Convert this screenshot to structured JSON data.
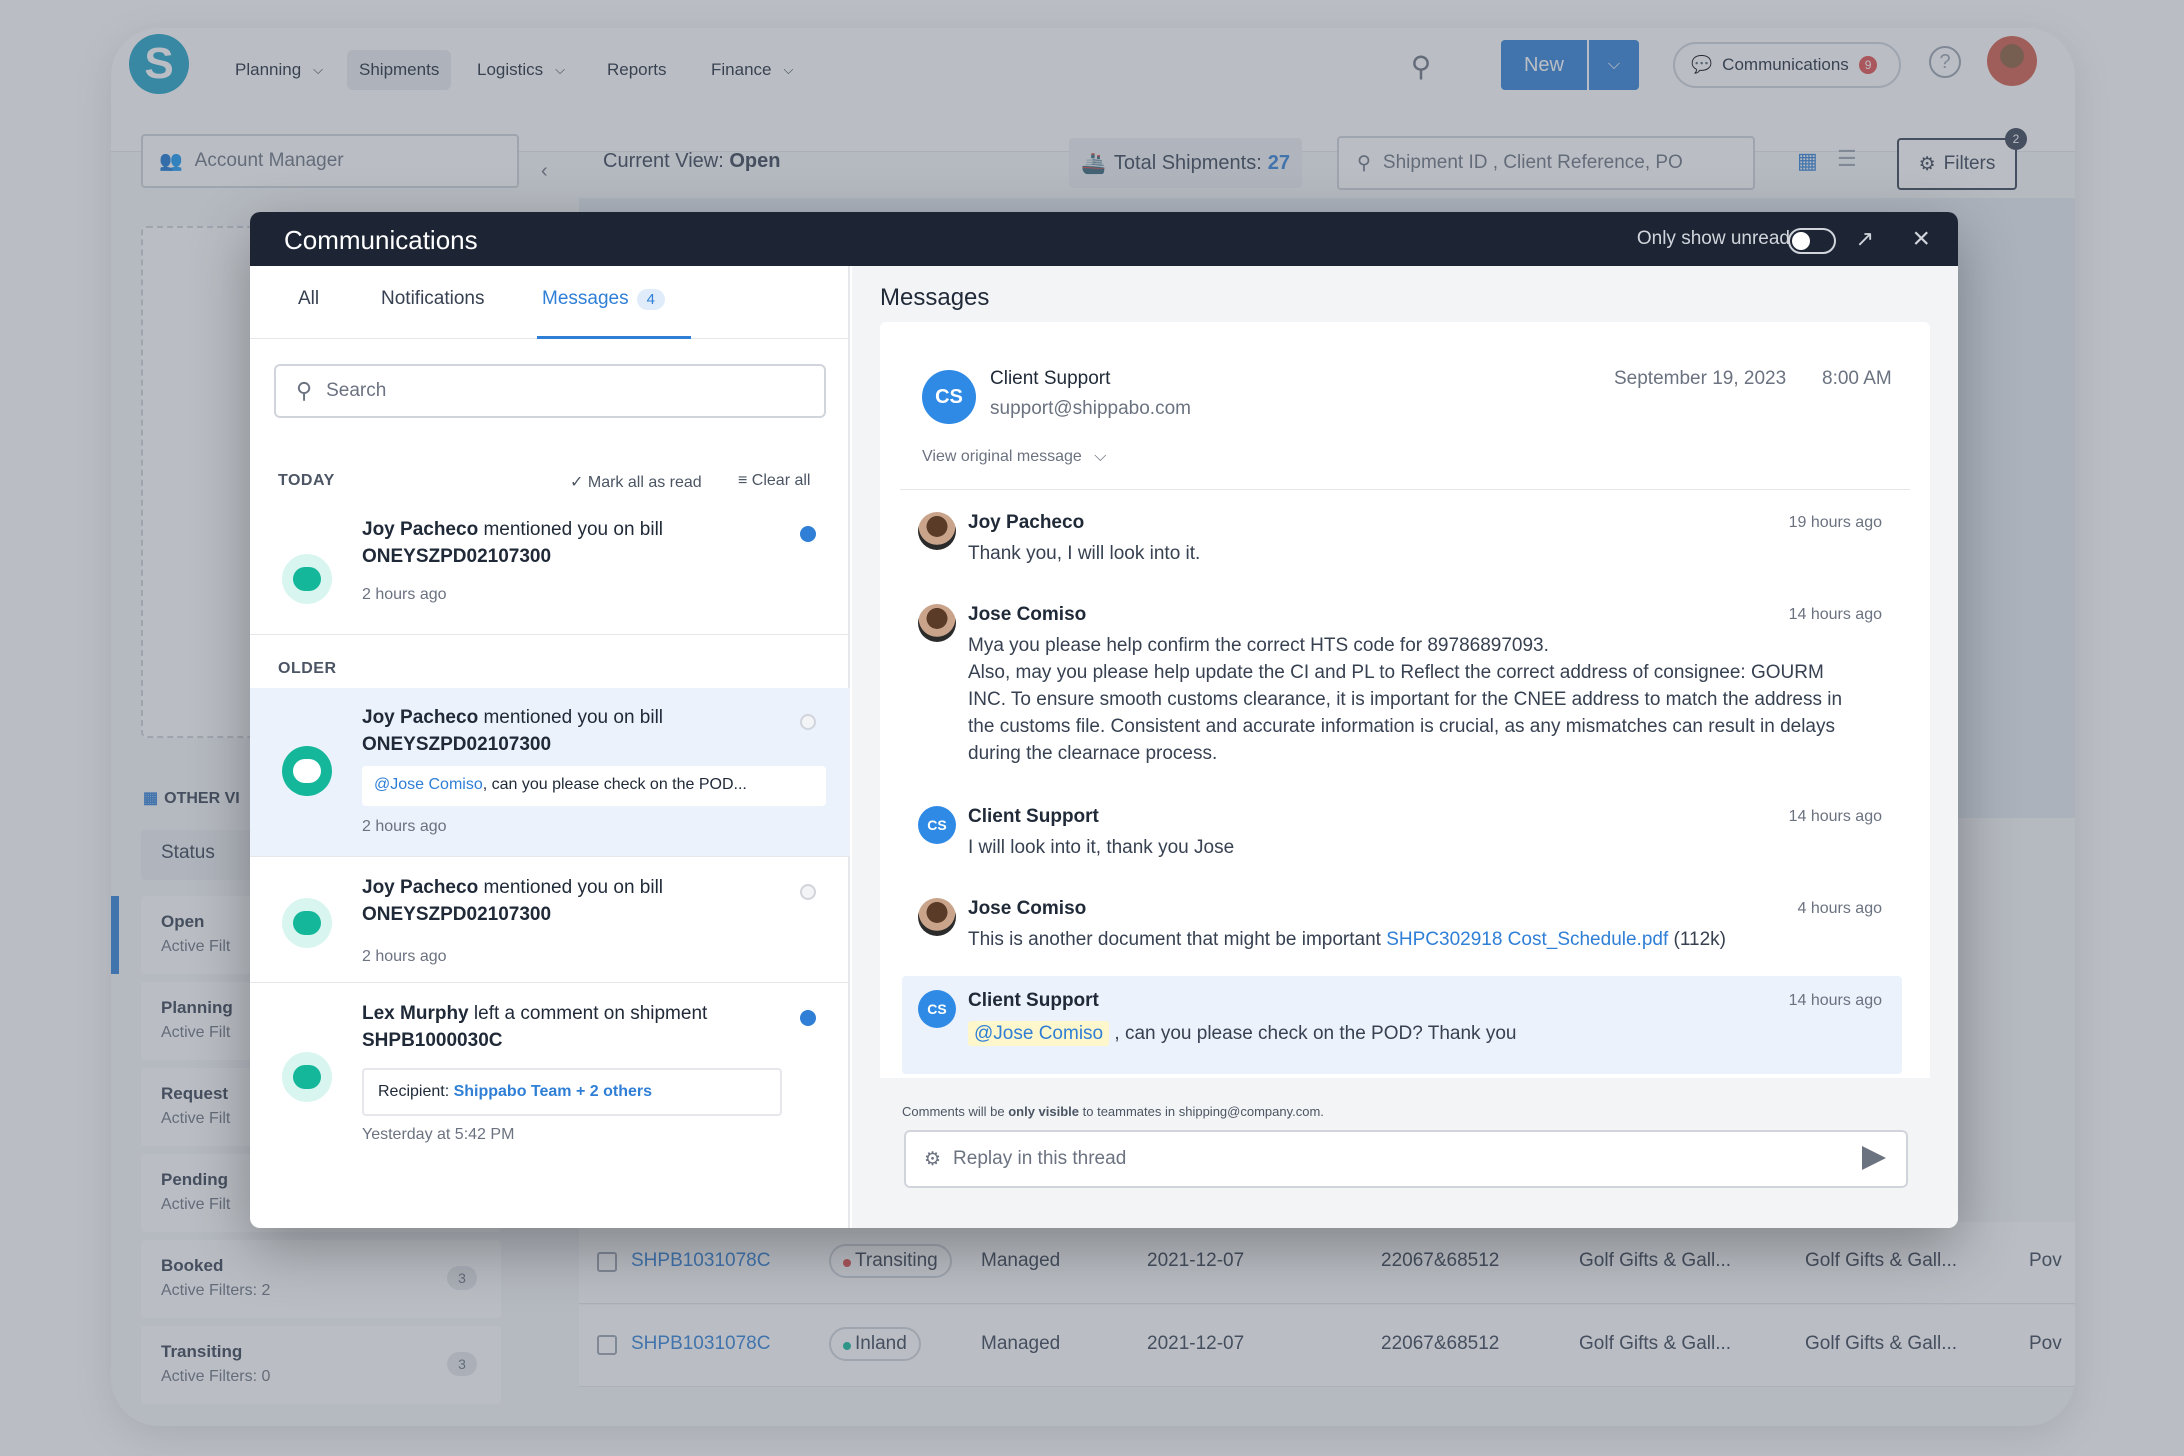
{
  "app": {
    "logo": "S",
    "nav": [
      {
        "label": "Planning",
        "dropdown": true
      },
      {
        "label": "Shipments",
        "dropdown": false
      },
      {
        "label": "Logistics",
        "dropdown": true
      },
      {
        "label": "Reports",
        "dropdown": false
      },
      {
        "label": "Finance",
        "dropdown": true
      }
    ],
    "new_label": "New",
    "communications_label": "Communications",
    "communications_count": "9",
    "help": "?"
  },
  "toolbar": {
    "account_manager": "Account Manager",
    "current_view_label": "Current View:",
    "current_view_value": "Open",
    "total_label": "Total Shipments:",
    "total_value": "27",
    "search_placeholder": "Shipment ID , Client Reference, PO",
    "filters_label": "Filters",
    "filters_count": "2"
  },
  "sidebar": {
    "other_views": "OTHER VI",
    "status_label": "Status",
    "items": [
      {
        "title": "Open",
        "sub": "Active Filt",
        "count": ""
      },
      {
        "title": "Planning",
        "sub": "Active Filt",
        "count": ""
      },
      {
        "title": "Request",
        "sub": "Active Filt",
        "count": ""
      },
      {
        "title": "Pending",
        "sub": "Active Filt",
        "count": ""
      },
      {
        "title": "Booked",
        "sub": "Active Filters: 2",
        "count": "3"
      },
      {
        "title": "Transiting",
        "sub": "Active Filters: 0",
        "count": "3"
      }
    ]
  },
  "table": {
    "rows": [
      {
        "id": "SHPB1031078C",
        "status": "Transiting",
        "status_color": "#e24c4c",
        "mgmt": "Managed",
        "date": "2021-12-07",
        "ref": "22067&68512",
        "shipper": "Golf Gifts & Gall...",
        "consignee": "Golf Gifts & Gall...",
        "extra": "Pov"
      },
      {
        "id": "SHPB1031078C",
        "status": "Inland",
        "status_color": "#14b79a",
        "mgmt": "Managed",
        "date": "2021-12-07",
        "ref": "22067&68512",
        "shipper": "Golf Gifts & Gall...",
        "consignee": "Golf Gifts & Gall...",
        "extra": "Pov"
      }
    ]
  },
  "modal": {
    "title": "Communications",
    "only_unread": "Only show unread",
    "tabs": {
      "all": "All",
      "notifications": "Notifications",
      "messages": "Messages",
      "messages_count": "4"
    },
    "search_placeholder": "Search",
    "today_label": "TODAY",
    "older_label": "OLDER",
    "mark_all_read": "Mark all as read",
    "clear_all": "Clear all",
    "notifications": [
      {
        "actor": "Joy Pacheco",
        "action": " mentioned you on bill",
        "ref": "ONEYSZPD02107300",
        "time": "2 hours ago"
      },
      {
        "actor": "Joy Pacheco",
        "action": " mentioned you on bill",
        "ref": "ONEYSZPD02107300",
        "quote_mention": "@Jose Comiso",
        "quote_text": ", can you please check on the POD...",
        "time": "2 hours ago"
      },
      {
        "actor": "Joy Pacheco",
        "action": " mentioned you on bill",
        "ref": "ONEYSZPD02107300",
        "time": "2 hours ago"
      },
      {
        "actor": "Lex Murphy",
        "action": " left a comment on shipment",
        "ref": "SHPB1000030C",
        "recipient_label": "Recipient: ",
        "recipient_value": "Shippabo Team + 2 others",
        "time": "Yesterday at 5:42 PM"
      }
    ],
    "messages_title": "Messages",
    "thread": {
      "sender": "Client Support",
      "sender_initials": "CS",
      "email": "support@shippabo.com",
      "date": "September 19, 2023",
      "time": "8:00 AM",
      "view_original": "View original message"
    },
    "messages": [
      {
        "name": "Joy Pacheco",
        "time": "19 hours ago",
        "body": "Thank you, I will look into it."
      },
      {
        "name": "Jose Comiso",
        "time": "14 hours ago",
        "body": "Mya you please help confirm the correct HTS code for 89786897093.\nAlso, may you please help update the CI and PL to Reflect the correct address of consignee: GOURM INC. To ensure smooth customs clearance, it is important for the CNEE address to match the address in the customs file. Consistent and accurate information is crucial, as any mismatches can result in delays during the clearnace process."
      },
      {
        "name": "Client Support",
        "initials": "CS",
        "time": "14 hours ago",
        "body": "I will look into it, thank you Jose"
      },
      {
        "name": "Jose Comiso",
        "time": "4 hours ago",
        "body": "This is another document that might be important ",
        "link": "SHPC302918 Cost_Schedule.pdf",
        "size": " (112k)"
      },
      {
        "name": "Client Support",
        "initials": "CS",
        "time": "14 hours ago",
        "mention": "@Jose Comiso",
        "body": " , can you please check on the POD? Thank you"
      }
    ],
    "visibility_pre": "Comments will be ",
    "visibility_bold": "only visible",
    "visibility_post": " to teammates in shipping@company.com.",
    "reply_placeholder": "Replay in this thread"
  }
}
